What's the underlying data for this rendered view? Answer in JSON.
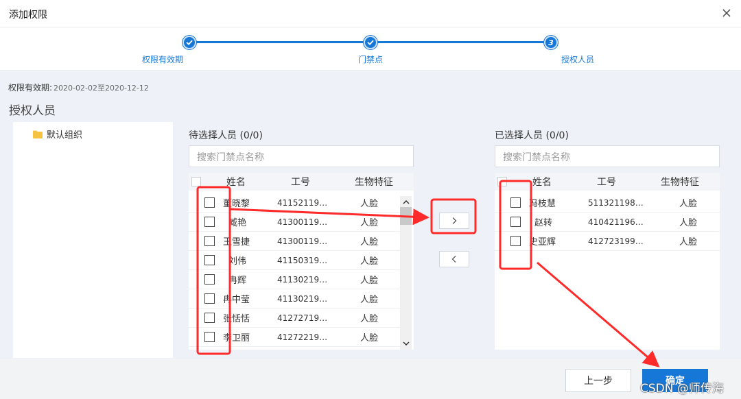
{
  "dialog": {
    "title": "添加权限"
  },
  "stepper": {
    "steps": [
      {
        "label": "权限有效期",
        "state": "done"
      },
      {
        "label": "门禁点",
        "state": "done"
      },
      {
        "label": "授权人员",
        "state": "current",
        "number": "3"
      }
    ],
    "accent_color": "#1777d6"
  },
  "validity": {
    "label": "权限有效期:",
    "value": "2020-02-02至2020-12-12"
  },
  "section_title": "授权人员",
  "tree": {
    "root": {
      "label": "默认组织",
      "icon": "folder-icon"
    }
  },
  "left_panel": {
    "title": "待选择人员 (0/0)",
    "search_placeholder": "搜索门禁点名称",
    "columns": [
      "姓名",
      "工号",
      "生物特征"
    ],
    "rows": [
      {
        "name": "董晓黎",
        "id": "41152119…",
        "bio": "人脸"
      },
      {
        "name": "臧艳",
        "id": "41300119…",
        "bio": "人脸"
      },
      {
        "name": "王雪捷",
        "id": "41300119…",
        "bio": "人脸"
      },
      {
        "name": "刘伟",
        "id": "41150319…",
        "bio": "人脸"
      },
      {
        "name": "冉辉",
        "id": "41130219…",
        "bio": "人脸"
      },
      {
        "name": "冉中莹",
        "id": "41130219…",
        "bio": "人脸"
      },
      {
        "name": "张恬恬",
        "id": "41272719…",
        "bio": "人脸"
      },
      {
        "name": "李卫丽",
        "id": "41272219…",
        "bio": "人脸"
      }
    ]
  },
  "transfer": {
    "to_right": "›",
    "to_left": "‹"
  },
  "right_panel": {
    "title": "已选择人员 (0/0)",
    "search_placeholder": "搜索门禁点名称",
    "columns": [
      "姓名",
      "工号",
      "生物特征"
    ],
    "rows": [
      {
        "name": "冯枝慧",
        "id": "511321198…",
        "bio": "人脸"
      },
      {
        "name": "赵转",
        "id": "410421196…",
        "bio": "人脸"
      },
      {
        "name": "史亚辉",
        "id": "412723199…",
        "bio": "人脸"
      }
    ]
  },
  "footer": {
    "prev_label": "上一步",
    "ok_label": "确定",
    "watermark": "CSDN @师传海"
  },
  "annotation_color": "#ff2a2a"
}
